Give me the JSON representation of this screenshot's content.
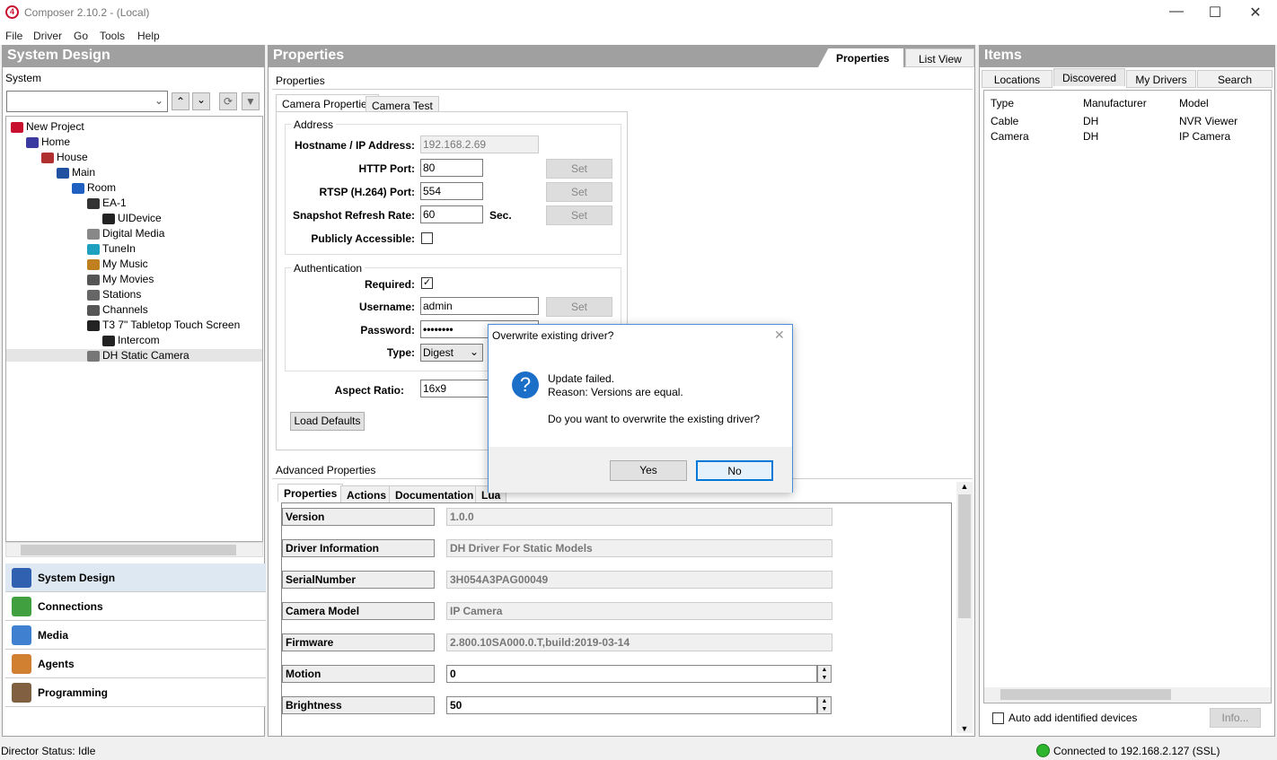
{
  "window": {
    "title": "Composer 2.10.2 - (Local)"
  },
  "menu": [
    "File",
    "Driver",
    "Go",
    "Tools",
    "Help"
  ],
  "left": {
    "header": "System Design",
    "sublabel": "System",
    "tree": [
      {
        "label": "New Project",
        "depth": 0,
        "color": "#c8102e"
      },
      {
        "label": "Home",
        "depth": 1,
        "color": "#3a3aa0"
      },
      {
        "label": "House",
        "depth": 2,
        "color": "#b03030"
      },
      {
        "label": "Main",
        "depth": 3,
        "color": "#2050a0"
      },
      {
        "label": "Room",
        "depth": 4,
        "color": "#2060c0"
      },
      {
        "label": "EA-1",
        "depth": 5,
        "color": "#333"
      },
      {
        "label": "UIDevice",
        "depth": 6,
        "color": "#222"
      },
      {
        "label": "Digital Media",
        "depth": 5,
        "color": "#888"
      },
      {
        "label": "TuneIn",
        "depth": 5,
        "color": "#20a0c0"
      },
      {
        "label": "My Music",
        "depth": 5,
        "color": "#c08020"
      },
      {
        "label": "My Movies",
        "depth": 5,
        "color": "#555"
      },
      {
        "label": "Stations",
        "depth": 5,
        "color": "#666"
      },
      {
        "label": "Channels",
        "depth": 5,
        "color": "#555"
      },
      {
        "label": "T3 7\" Tabletop Touch Screen",
        "depth": 5,
        "color": "#222"
      },
      {
        "label": "Intercom",
        "depth": 6,
        "color": "#222"
      },
      {
        "label": "DH Static Camera",
        "depth": 5,
        "color": "#777",
        "selected": true
      }
    ],
    "nav": [
      {
        "label": "System Design",
        "color": "#3060b0",
        "active": true
      },
      {
        "label": "Connections",
        "color": "#40a040"
      },
      {
        "label": "Media",
        "color": "#4080d0"
      },
      {
        "label": "Agents",
        "color": "#d08030"
      },
      {
        "label": "Programming",
        "color": "#806040"
      }
    ]
  },
  "middle": {
    "header": "Properties",
    "top_tabs": [
      "Properties",
      "List View"
    ],
    "sublabel": "Properties",
    "cam_tabs": [
      "Camera Properties",
      "Camera Test"
    ],
    "address_group": "Address",
    "auth_group": "Authentication",
    "hostname_label": "Hostname / IP Address:",
    "hostname": "192.168.2.69",
    "http_label": "HTTP Port:",
    "http": "80",
    "rtsp_label": "RTSP (H.264) Port:",
    "rtsp": "554",
    "snap_label": "Snapshot Refresh Rate:",
    "snap": "60",
    "sec": "Sec.",
    "public_label": "Publicly Accessible:",
    "required_label": "Required:",
    "required_check": "✓",
    "user_label": "Username:",
    "user": "admin",
    "pass_label": "Password:",
    "pass": "••••••••",
    "type_label": "Type:",
    "type": "Digest",
    "aspect_label": "Aspect Ratio:",
    "aspect": "16x9",
    "set": "Set",
    "load_defaults": "Load Defaults",
    "adv_label": "Advanced Properties",
    "adv_tabs": [
      "Properties",
      "Actions",
      "Documentation",
      "Lua"
    ],
    "adv_rows": [
      {
        "k": "Version",
        "v": "1.0.0"
      },
      {
        "k": "Driver Information",
        "v": "DH Driver For Static Models"
      },
      {
        "k": "SerialNumber",
        "v": "3H054A3PAG00049"
      },
      {
        "k": "Camera Model",
        "v": "IP Camera"
      },
      {
        "k": "Firmware",
        "v": "2.800.10SA000.0.T,build:2019-03-14"
      },
      {
        "k": "Motion",
        "v": "0",
        "editable": true
      },
      {
        "k": "Brightness",
        "v": "50",
        "editable": true
      }
    ]
  },
  "right": {
    "header": "Items",
    "tabs": [
      "Locations",
      "Discovered",
      "My Drivers",
      "Search"
    ],
    "columns": [
      "Type",
      "Manufacturer",
      "Model"
    ],
    "rows": [
      [
        "Cable",
        "DH",
        "NVR Viewer"
      ],
      [
        "Camera",
        "DH",
        "IP Camera"
      ]
    ],
    "auto_add": "Auto add identified devices",
    "info": "Info..."
  },
  "dialog": {
    "title": "Overwrite existing driver?",
    "line1": "Update failed.",
    "line2": "Reason: Versions are equal.",
    "line3": "Do you want to overwrite the existing driver?",
    "yes": "Yes",
    "no": "No",
    "icon": "?"
  },
  "status": {
    "left": "Director Status: Idle",
    "right": "Connected to 192.168.2.127 (SSL)",
    "led": "#2db52d"
  }
}
